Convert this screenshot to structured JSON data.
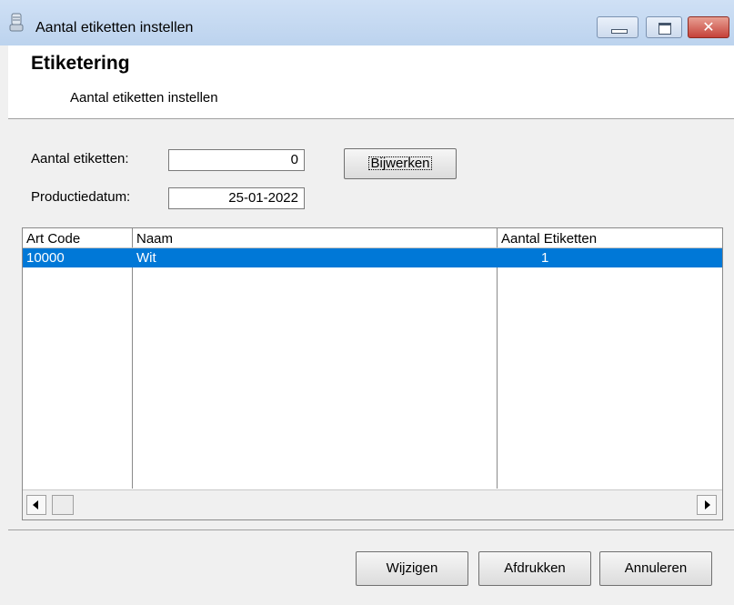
{
  "window": {
    "title": "Aantal etiketten instellen",
    "icon": "label-printer-icon"
  },
  "header": {
    "title": "Etiketering",
    "subtitle": "Aantal etiketten instellen"
  },
  "form": {
    "aantal_label": "Aantal etiketten:",
    "aantal_value": "0",
    "datum_label": "Productiedatum:",
    "datum_value": "25-01-2022",
    "update_button": "Bijwerken"
  },
  "table": {
    "columns": [
      "Art Code",
      "Naam",
      "Aantal Etiketten"
    ],
    "rows": [
      {
        "art_code": "10000",
        "naam": "Wit",
        "aantal": "1"
      }
    ]
  },
  "footer": {
    "edit_button": "Wijzigen",
    "print_button": "Afdrukken",
    "cancel_button": "Annuleren"
  },
  "colors": {
    "selection": "#0078d7",
    "close_button": "#c5413a"
  }
}
